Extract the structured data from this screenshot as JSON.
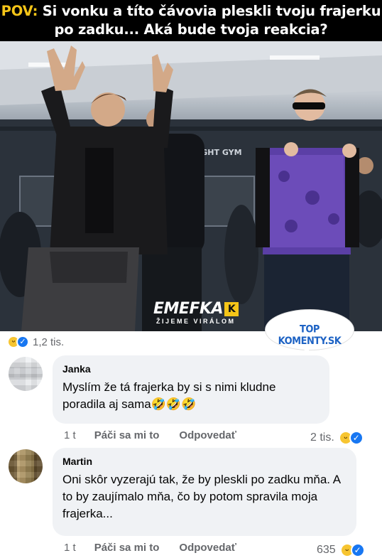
{
  "post": {
    "caption_prefix": "POV:",
    "caption_rest": " Si vonku a títo čávovia pleskli tvoju frajerku po zadku... Aká bude tvoja reakcia?",
    "brand_name": "EMEFKA",
    "brand_tagline": "ŽIJEME VIRÁLOM",
    "banner_text": "SPARTAKUS FIGHT GYM",
    "watermark": "TOP KOMENTY.SK",
    "reaction_count": "1,2 tis."
  },
  "comments": [
    {
      "author": "Janka",
      "text": "Myslím že tá frajerka by si s nimi kludne poradila aj sama🤣🤣🤣",
      "time": "1 t",
      "like_label": "Páči sa mi to",
      "reply_label": "Odpovedať",
      "reactions": "2 tis."
    },
    {
      "author": "Martin",
      "text": "Oni skôr vyzerajú tak,  že by pleskli po zadku mňa. A to by zaujímalo mňa,  čo by potom spravila moja frajerka...",
      "time": "1 t",
      "like_label": "Páči sa mi to",
      "reply_label": "Odpovedať",
      "reactions": "635"
    }
  ],
  "icons": {
    "haha": "😆",
    "like": "👍"
  },
  "colors": {
    "caption_accent": "#f5c518",
    "caption_bg": "#000000",
    "bubble_bg": "#f0f2f5",
    "meta_text": "#65676b",
    "like_blue": "#1877f2",
    "watermark_blue": "#1e63c4"
  }
}
